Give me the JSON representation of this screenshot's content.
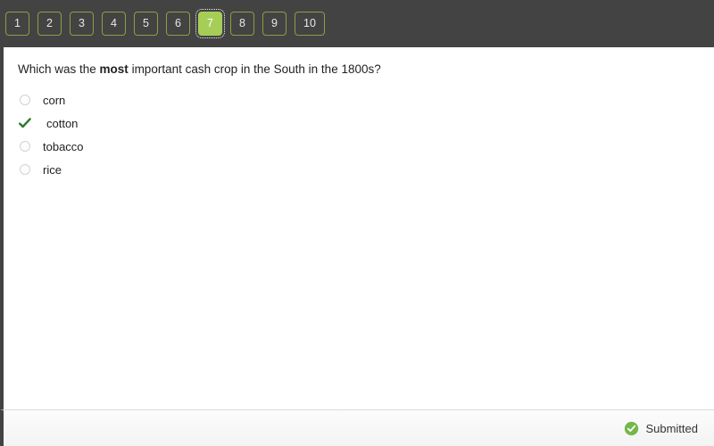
{
  "nav": {
    "aria_label": "Question navigator",
    "current_index": 7,
    "buttons": [
      {
        "label": "1",
        "state": "available"
      },
      {
        "label": "2",
        "state": "available"
      },
      {
        "label": "3",
        "state": "available"
      },
      {
        "label": "4",
        "state": "available"
      },
      {
        "label": "5",
        "state": "available"
      },
      {
        "label": "6",
        "state": "available"
      },
      {
        "label": "7",
        "state": "current"
      },
      {
        "label": "8",
        "state": "available"
      },
      {
        "label": "9",
        "state": "available"
      },
      {
        "label": "10",
        "state": "available"
      }
    ]
  },
  "question": {
    "prefix": "Which was the ",
    "emphasis": "most",
    "suffix": " important cash crop in the South in the 1800s?",
    "options": [
      {
        "label": "corn",
        "marker": "radio-unselected-icon",
        "selected": false
      },
      {
        "label": "cotton",
        "marker": "green-check-icon",
        "selected": true
      },
      {
        "label": "tobacco",
        "marker": "radio-unselected-icon",
        "selected": false
      },
      {
        "label": "rice",
        "marker": "radio-unselected-icon",
        "selected": false
      }
    ]
  },
  "footer": {
    "status_icon": "check-circle-icon",
    "status_label": "Submitted"
  },
  "colors": {
    "header_bg": "#434343",
    "nav_border": "#88a046",
    "nav_current_bg": "#a6ce57",
    "check_green": "#2d7a2d",
    "status_green": "#74b74a",
    "panel_bg": "#ffffff"
  }
}
